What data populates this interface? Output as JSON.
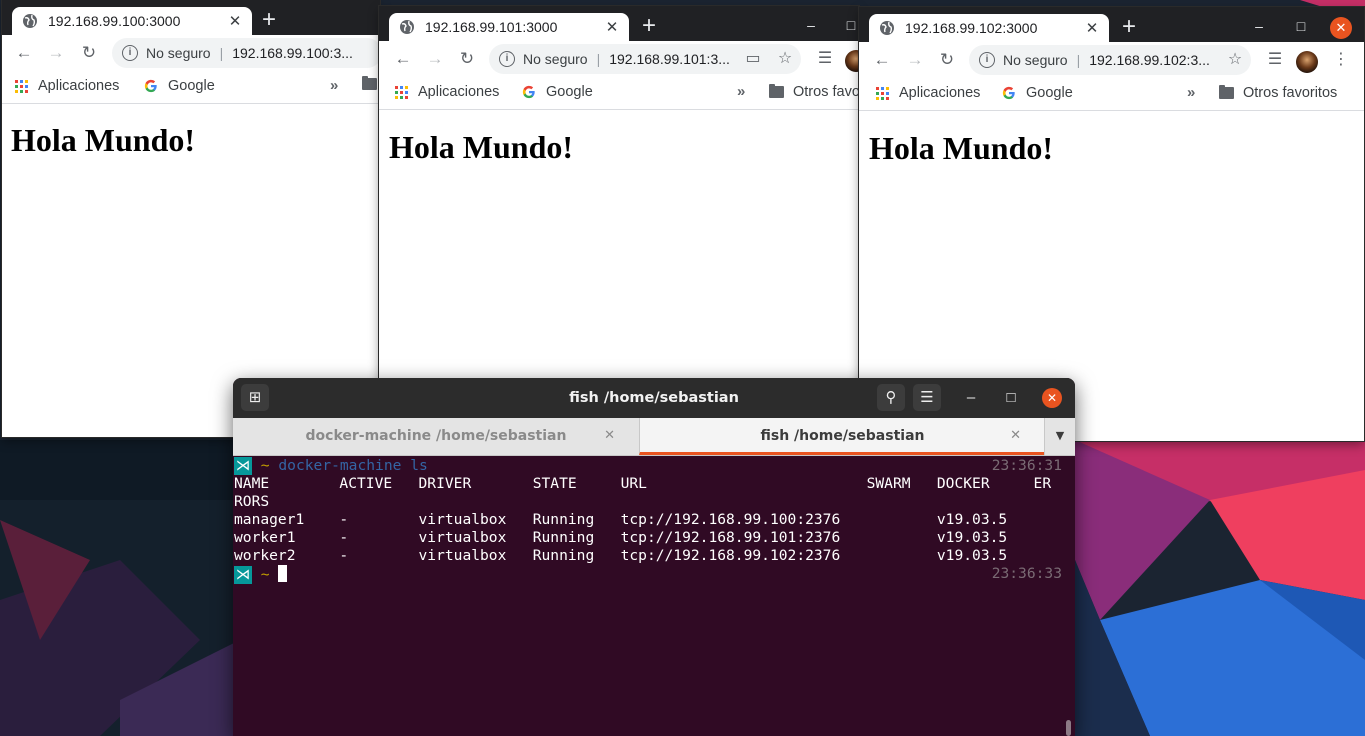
{
  "browser_common": {
    "new_tab": "+",
    "insecure_label": "No seguro",
    "bookmarks": {
      "apps": "Aplicaciones",
      "google": "Google",
      "overflow": "»",
      "others": "Otros favoritos",
      "others_cut": "Otros favo"
    },
    "page_heading": "Hola Mundo!",
    "tab_close": "✕"
  },
  "windows": [
    {
      "tab_title": "192.168.99.100:3000",
      "url": "192.168.99.100:3..."
    },
    {
      "tab_title": "192.168.99.101:3000",
      "url": "192.168.99.101:3..."
    },
    {
      "tab_title": "192.168.99.102:3000",
      "url": "192.168.99.102:3..."
    }
  ],
  "terminal": {
    "title": "fish /home/sebastian",
    "tabs": [
      {
        "label": "docker-machine /home/sebastian"
      },
      {
        "label": "fish /home/sebastian"
      }
    ],
    "lines": {
      "prompt_symbol": "⋊",
      "tilde": "~",
      "command": "docker-machine",
      "command_arg": "ls",
      "ts1": "23:36:31",
      "header": "NAME        ACTIVE   DRIVER       STATE     URL                         SWARM   DOCKER     ER",
      "header_wrap": "RORS",
      "row1": "manager1    -        virtualbox   Running   tcp://192.168.99.100:2376           v19.03.5",
      "row2": "worker1     -        virtualbox   Running   tcp://192.168.99.101:2376           v19.03.5",
      "row3": "worker2     -        virtualbox   Running   tcp://192.168.99.102:2376           v19.03.5",
      "ts2": "23:36:33"
    }
  },
  "colors": {
    "ubuntu_orange": "#e95420",
    "terminal_bg": "#300a24",
    "chrome_dark": "#202124"
  }
}
